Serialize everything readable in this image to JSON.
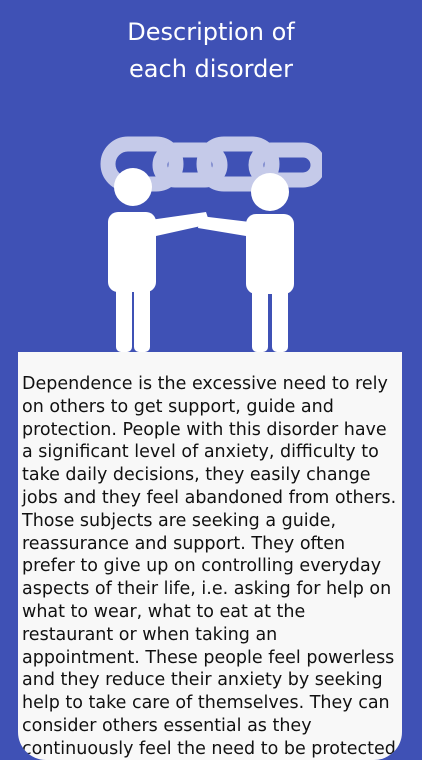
{
  "header": {
    "title_line1": "Description of",
    "title_line2": "each disorder"
  },
  "illustration": {
    "icon": "dependence-icon",
    "chain_color": "#c5cae9",
    "figure_color": "#ffffff"
  },
  "description": {
    "text": "Dependence is the excessive need to rely on others to get support, guide and protection. People with this disorder have a significant level of anxiety, difficulty to take daily decisions, they easily change jobs and they feel abandoned from others. Those subjects are seeking a guide, reassurance and support. They often prefer to give up on controlling everyday aspects of their life, i.e. asking for help on what to wear, what to eat at the restaurant or when taking an appointment. These people feel powerless and they reduce their anxiety by seeking help to take care of themselves. They can consider others essential as they continuously feel the need to be protected"
  },
  "colors": {
    "background": "#3f51b5",
    "card": "#f8f8f8",
    "text": "#111111"
  }
}
